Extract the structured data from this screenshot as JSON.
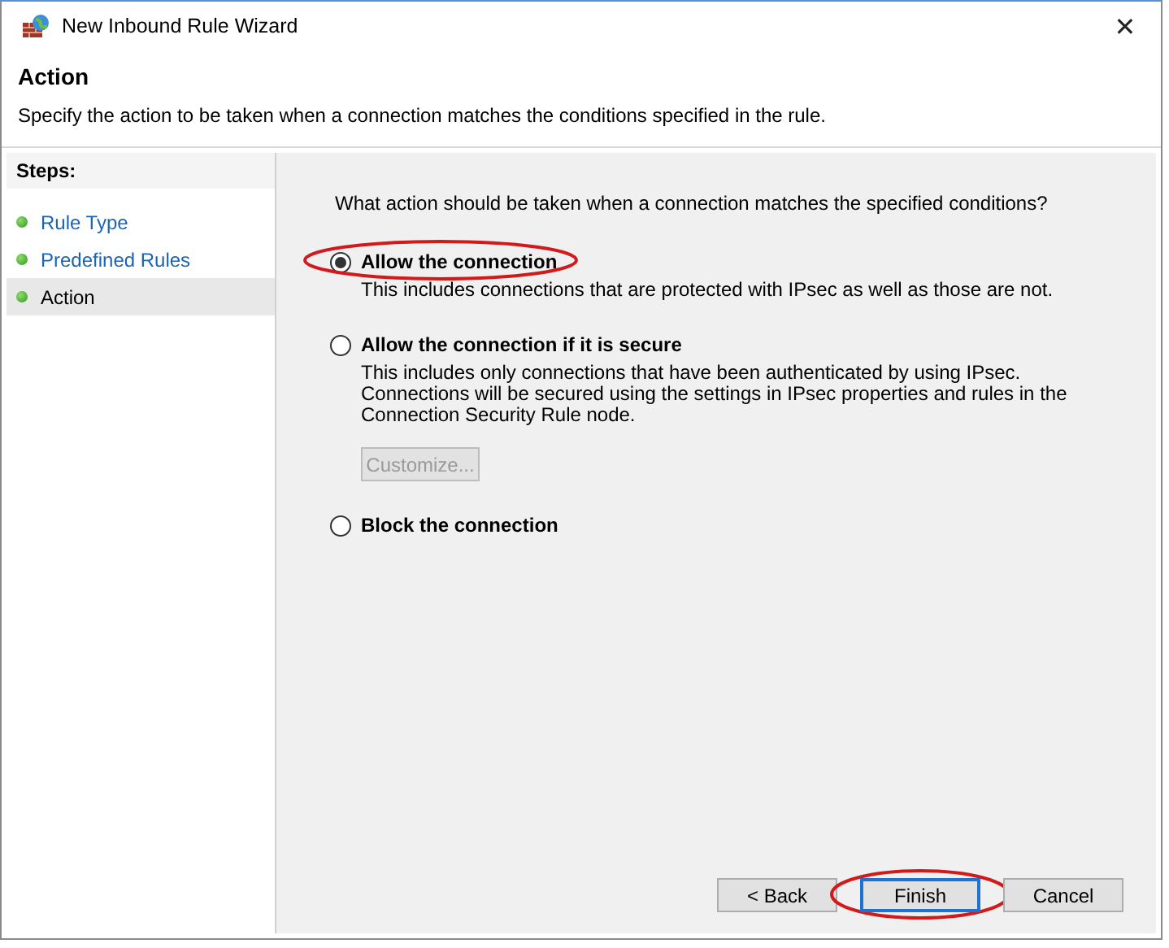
{
  "window": {
    "title": "New Inbound Rule Wizard",
    "close": "✕"
  },
  "header": {
    "title": "Action",
    "description": "Specify the action to be taken when a connection matches the conditions specified in the rule."
  },
  "steps": {
    "heading": "Steps:",
    "items": [
      {
        "label": "Rule Type",
        "selected": false
      },
      {
        "label": "Predefined Rules",
        "selected": false
      },
      {
        "label": "Action",
        "selected": true
      }
    ]
  },
  "question": "What action should be taken when a connection matches the specified conditions?",
  "options": [
    {
      "label": "Allow the connection",
      "selected": true,
      "highlighted": true,
      "description": "This includes connections that are protected with IPsec as well as those are not."
    },
    {
      "label": "Allow the connection if it is secure",
      "selected": false,
      "highlighted": false,
      "description": "This includes only connections that have been authenticated by using IPsec.  Connections will be secured using the settings in IPsec properties and rules in the Connection Security Rule node.",
      "button": {
        "label": "Customize...",
        "disabled": true
      }
    },
    {
      "label": "Block the connection",
      "selected": false,
      "highlighted": false
    }
  ],
  "buttons": [
    {
      "label": "< Back",
      "default": false,
      "highlighted": false
    },
    {
      "label": "Finish",
      "default": true,
      "highlighted": true
    },
    {
      "label": "Cancel",
      "default": false,
      "highlighted": false
    }
  ]
}
